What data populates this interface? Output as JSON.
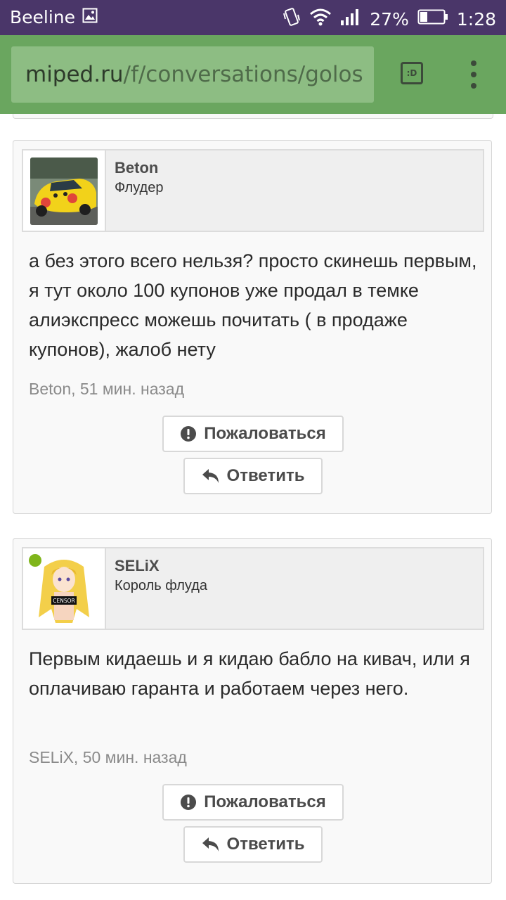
{
  "status_bar": {
    "carrier": "Beeline",
    "battery": "27%",
    "time": "1:28"
  },
  "browser": {
    "url_domain": "miped.ru",
    "url_path": "/f/conversations/golos",
    "tab_icon_label": ":D"
  },
  "posts": [
    {
      "username": "Beton",
      "user_title": "Флудер",
      "message": "а без этого всего нельзя? просто скинешь первым, я тут около 100 купонов уже продал в темке алиэкспресс можешь почитать ( в продаже купонов), жалоб нету",
      "meta": "Beton, 51 мин. назад",
      "report_label": "Пожаловаться",
      "reply_label": "Ответить"
    },
    {
      "username": "SELiX",
      "user_title": "Король флуда",
      "message": "Первым кидаешь и я кидаю бабло на кивач, или я оплачиваю гаранта и работаем через него.",
      "meta": "SELiX, 50 мин. назад",
      "report_label": "Пожаловаться",
      "reply_label": "Ответить",
      "avatar_censor_text": "CENSOR"
    }
  ],
  "colors": {
    "status_bar": "#4a3669",
    "browser_bar": "#6aa65f",
    "online": "#7fb51b"
  }
}
